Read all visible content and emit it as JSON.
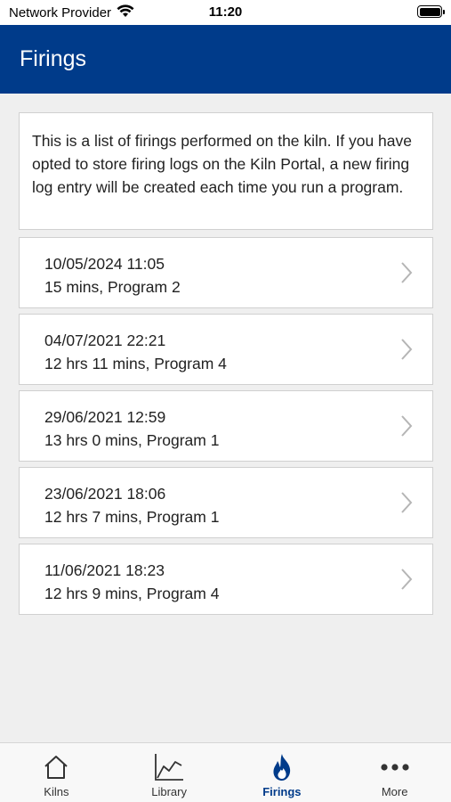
{
  "status_bar": {
    "carrier": "Network Provider",
    "time": "11:20"
  },
  "header": {
    "title": "Firings"
  },
  "info": {
    "text": "This is a list of firings performed on the kiln. If you have opted to store firing logs on the Kiln Portal, a new firing log entry will be created each time you run a program."
  },
  "firings": [
    {
      "datetime": "10/05/2024 11:05",
      "summary": "15 mins, Program 2"
    },
    {
      "datetime": "04/07/2021 22:21",
      "summary": "12 hrs 11 mins, Program 4"
    },
    {
      "datetime": "29/06/2021 12:59",
      "summary": "13 hrs 0 mins, Program 1"
    },
    {
      "datetime": "23/06/2021 18:06",
      "summary": "12 hrs 7 mins, Program 1"
    },
    {
      "datetime": "11/06/2021 18:23",
      "summary": "12 hrs 9 mins, Program 4"
    }
  ],
  "tabs": [
    {
      "label": "Kilns",
      "icon": "home-icon"
    },
    {
      "label": "Library",
      "icon": "chart-icon"
    },
    {
      "label": "Firings",
      "icon": "flame-icon"
    },
    {
      "label": "More",
      "icon": "more-icon"
    }
  ],
  "colors": {
    "header_bg": "#003b8a",
    "active_tab": "#003b8a",
    "page_bg": "#efefef"
  }
}
